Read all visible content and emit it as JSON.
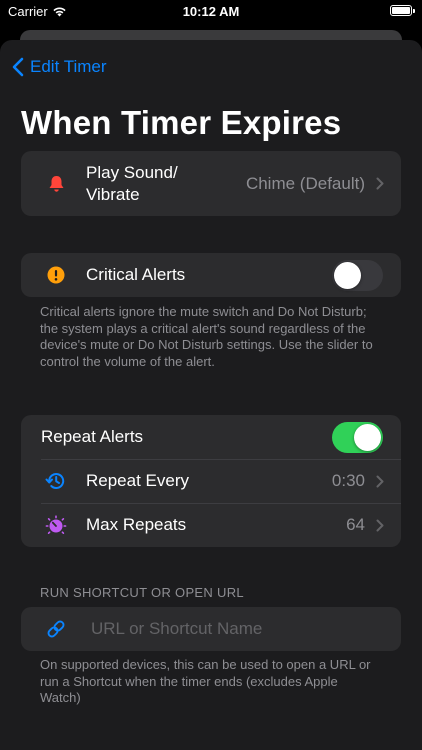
{
  "status_bar": {
    "carrier": "Carrier",
    "time": "10:12 AM"
  },
  "nav": {
    "back_label": "Edit Timer"
  },
  "page": {
    "title": "When Timer Expires"
  },
  "sound": {
    "label_line1": "Play Sound/",
    "label_line2": "Vibrate",
    "value": "Chime (Default)",
    "icon": "bell-icon"
  },
  "critical": {
    "label": "Critical Alerts",
    "enabled": false,
    "icon": "exclamation-circle-icon",
    "footer": "Critical alerts ignore the mute switch and Do Not Disturb; the system plays a critical alert's sound regardless of the device's mute or Do Not Disturb settings. Use the slider to control the volume of the alert."
  },
  "repeat": {
    "label": "Repeat Alerts",
    "enabled": true,
    "every_label": "Repeat Every",
    "every_value": "0:30",
    "every_icon": "clock-repeat-icon",
    "max_label": "Max Repeats",
    "max_value": "64",
    "max_icon": "gauge-icon"
  },
  "shortcut": {
    "header": "RUN SHORTCUT OR OPEN URL",
    "placeholder": "URL or Shortcut Name",
    "icon": "link-icon",
    "footer": "On supported devices, this can be used to open a URL or run a Shortcut when the timer ends (excludes Apple Watch)"
  },
  "colors": {
    "accent": "#0a84ff",
    "toggle_on": "#30d158",
    "bell": "#ff453a",
    "critical": "#ff9f0a",
    "max_repeats": "#bf5af2"
  }
}
